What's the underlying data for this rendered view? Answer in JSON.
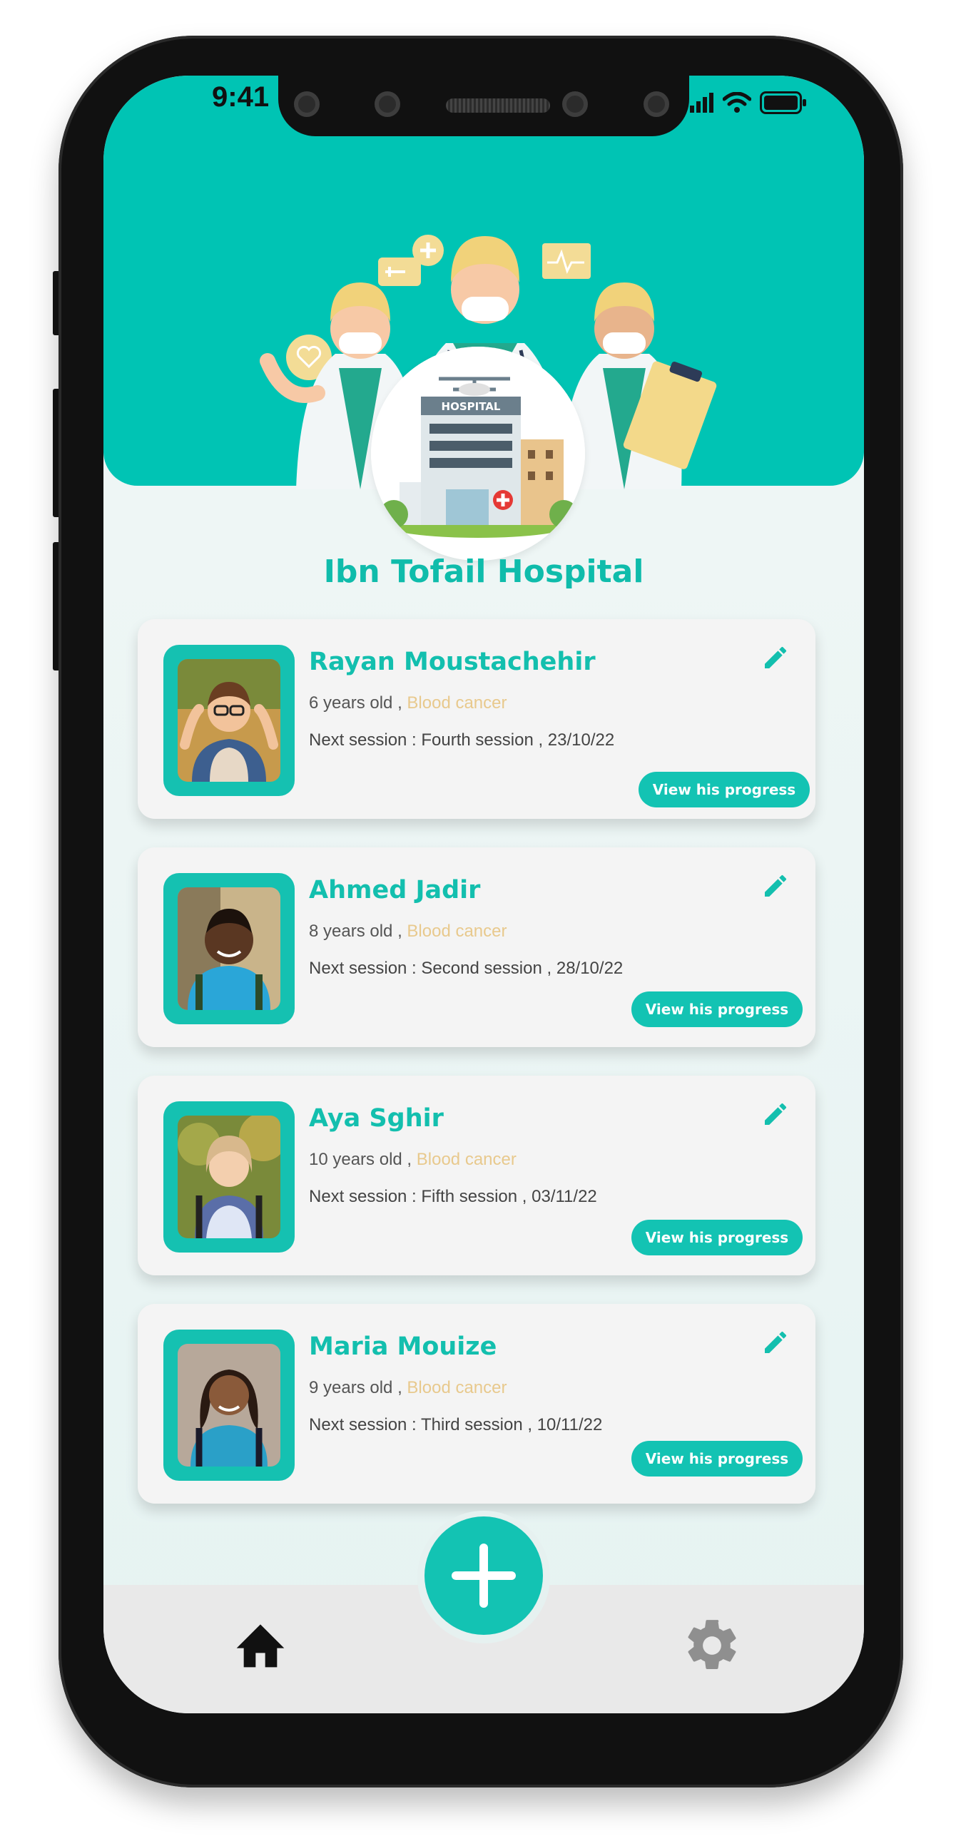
{
  "status_bar": {
    "time": "9:41"
  },
  "header": {
    "hospital_name": "Ibn Tofail Hospital",
    "hospital_sign": "HOSPITAL"
  },
  "patients": [
    {
      "name": "Rayan Moustachehir",
      "age": "6 years old ,",
      "diagnosis": "Blood cancer",
      "session": "Next session : Fourth session , 23/10/22",
      "button": "View his progress"
    },
    {
      "name": "Ahmed Jadir",
      "age": "8 years old ,",
      "diagnosis": "Blood cancer",
      "session": "Next session : Second session , 28/10/22",
      "button": "View his progress"
    },
    {
      "name": "Aya Sghir",
      "age": "10 years old ,",
      "diagnosis": "Blood cancer",
      "session": "Next session : Fifth session , 03/11/22",
      "button": "View his progress"
    },
    {
      "name": "Maria Mouize",
      "age": "9 years old ,",
      "diagnosis": "Blood cancer",
      "session": "Next session : Third session , 10/11/22",
      "button": "View his progress"
    }
  ],
  "bottom_nav": {
    "home_icon": "home-icon",
    "add_icon": "plus-icon",
    "settings_icon": "gear-icon"
  },
  "colors": {
    "accent": "#13c3b3",
    "diagnosis": "#e8c98d",
    "name": "#13bfae"
  }
}
